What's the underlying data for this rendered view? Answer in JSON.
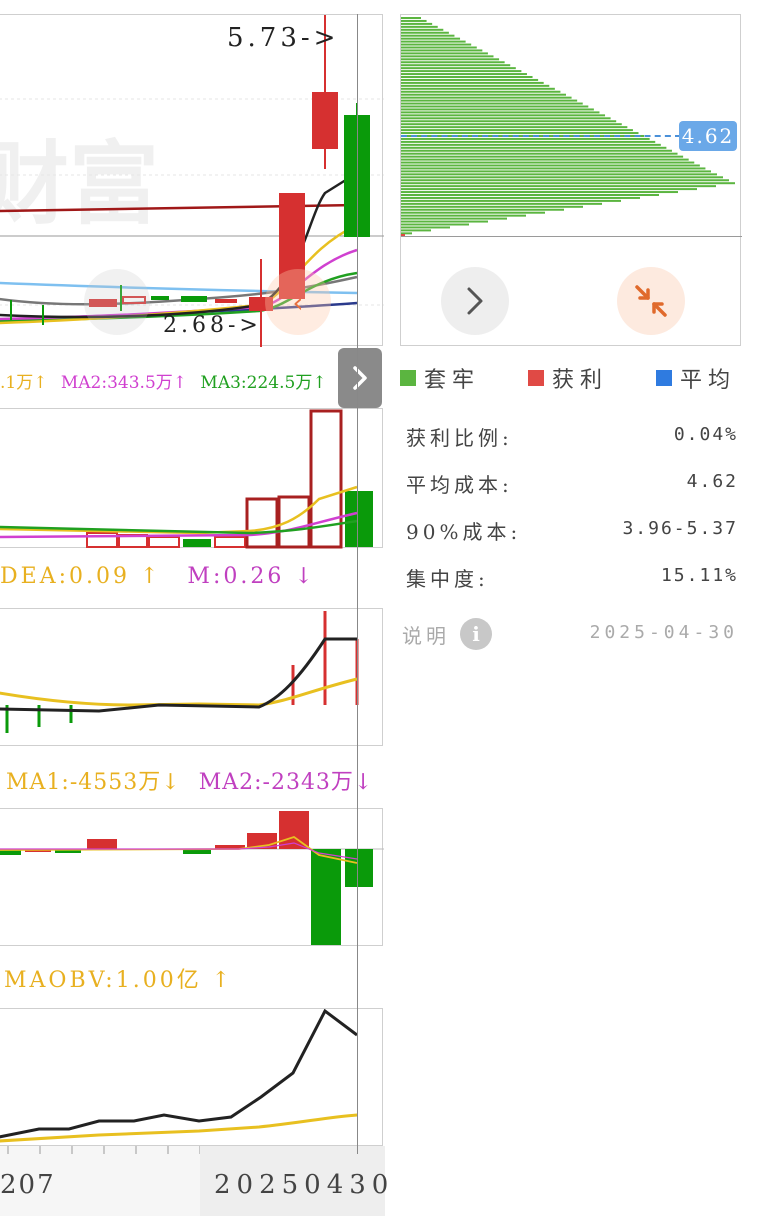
{
  "kline": {
    "high_annotation": "5.73->",
    "low_annotation": "2.68->",
    "watermark": "财富"
  },
  "volume_indicator": {
    "label_prefix": ".1万↑",
    "ma2": "MA2:343.5万↑",
    "ma3": "MA3:224.5万↑"
  },
  "macd_indicator": {
    "dea": "DEA:0.09 ↑",
    "m": "M:0.26 ↓"
  },
  "fund_indicator": {
    "ma1": "MA1:-4553万↓",
    "ma2": "MA2:-2343万↓"
  },
  "obv_indicator": {
    "maobv": "MAOBV:1.00亿 ↑"
  },
  "date_axis": {
    "left_date": "207",
    "right_date": "20250430"
  },
  "chip": {
    "avg_price_tag": "4.62",
    "legend": [
      {
        "label": "套牢",
        "color": "#5bb540"
      },
      {
        "label": "获利",
        "color": "#e04a45"
      },
      {
        "label": "平均",
        "color": "#2f7be0"
      }
    ],
    "stats": [
      {
        "label": "获利比例:",
        "value": "0.04%"
      },
      {
        "label": "平均成本:",
        "value": "4.62"
      },
      {
        "label": "90%成本:",
        "value": "3.96-5.37"
      },
      {
        "label": "集中度:",
        "value": "15.11%"
      }
    ],
    "explain_label": "说明",
    "date": "2025-04-30"
  },
  "colors": {
    "up": "#d63030",
    "down": "#0a9a0a",
    "ma_black": "#222222",
    "ma_yellow": "#e8c020",
    "ma_magenta": "#d040d0",
    "ma_green": "#20a020",
    "chip_green": "#5bb540",
    "avg_blue": "#4a90d9"
  }
}
